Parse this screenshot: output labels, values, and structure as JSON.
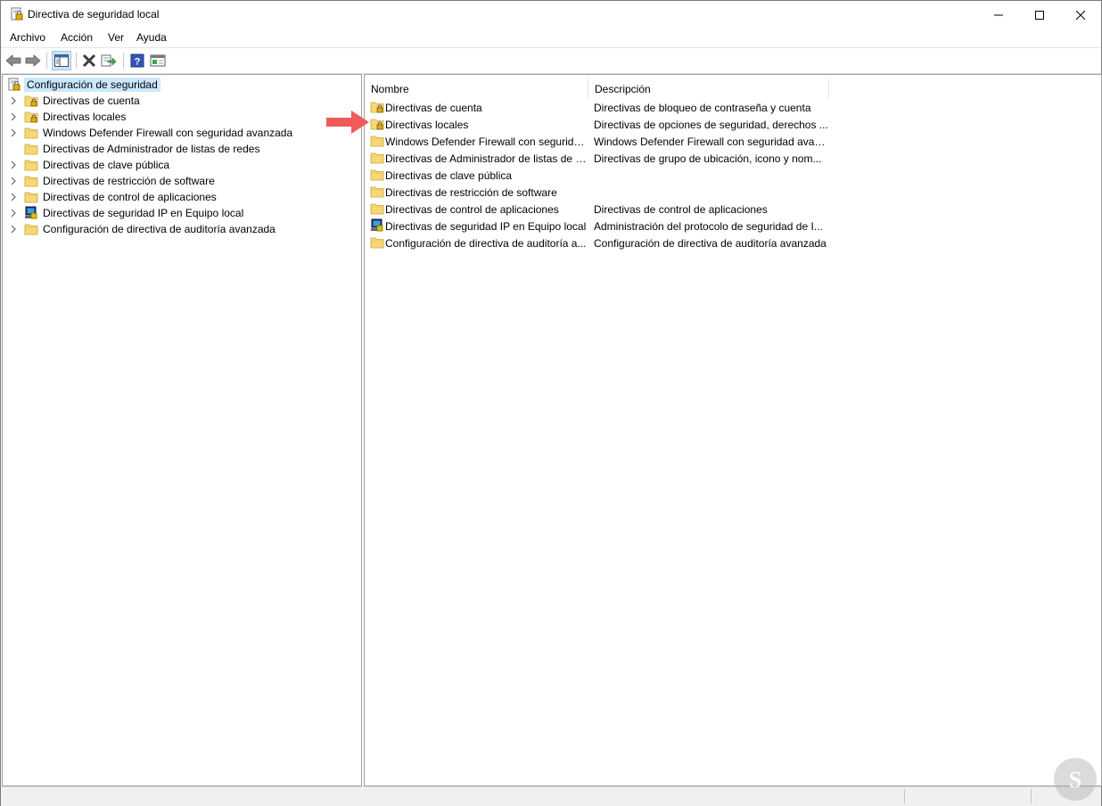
{
  "window": {
    "title": "Directiva de seguridad local"
  },
  "menu": [
    "Archivo",
    "Acción",
    "Ver",
    "Ayuda"
  ],
  "toolbar": {
    "icons": [
      "back-icon",
      "forward-icon",
      "show-hide-tree-icon",
      "delete-icon",
      "export-list-icon",
      "help-icon",
      "properties-icon"
    ]
  },
  "tree": {
    "root": "Configuración de seguridad",
    "items": [
      {
        "label": "Directivas de cuenta",
        "icon": "folder-lock-icon",
        "expandable": true
      },
      {
        "label": "Directivas locales",
        "icon": "folder-lock-icon",
        "expandable": true
      },
      {
        "label": "Windows Defender Firewall con seguridad avanzada",
        "icon": "folder-icon",
        "expandable": true
      },
      {
        "label": "Directivas de Administrador de listas de redes",
        "icon": "folder-icon",
        "expandable": false
      },
      {
        "label": "Directivas de clave pública",
        "icon": "folder-icon",
        "expandable": true
      },
      {
        "label": "Directivas de restricción de software",
        "icon": "folder-icon",
        "expandable": true
      },
      {
        "label": "Directivas de control de aplicaciones",
        "icon": "folder-icon",
        "expandable": true
      },
      {
        "label": "Directivas de seguridad IP en Equipo local",
        "icon": "ip-security-icon",
        "expandable": true
      },
      {
        "label": "Configuración de directiva de auditoría avanzada",
        "icon": "folder-icon",
        "expandable": true
      }
    ]
  },
  "list": {
    "columns": [
      "Nombre",
      "Descripción"
    ],
    "rows": [
      {
        "name": "Directivas de cuenta",
        "desc": "Directivas de bloqueo de contraseña y cuenta",
        "icon": "folder-lock-icon"
      },
      {
        "name": "Directivas locales",
        "desc": "Directivas de opciones de seguridad, derechos ...",
        "icon": "folder-lock-icon"
      },
      {
        "name": "Windows Defender Firewall con segurida...",
        "desc": "Windows Defender Firewall con seguridad avan...",
        "icon": "folder-icon"
      },
      {
        "name": "Directivas de Administrador de listas de r...",
        "desc": "Directivas de grupo de ubicación, icono y nom...",
        "icon": "folder-icon"
      },
      {
        "name": "Directivas de clave pública",
        "desc": "",
        "icon": "folder-icon"
      },
      {
        "name": "Directivas de restricción de software",
        "desc": "",
        "icon": "folder-icon"
      },
      {
        "name": "Directivas de control de aplicaciones",
        "desc": "Directivas de control de aplicaciones",
        "icon": "folder-icon"
      },
      {
        "name": "Directivas de seguridad IP en Equipo local",
        "desc": "Administración del protocolo de seguridad de I...",
        "icon": "ip-security-icon"
      },
      {
        "name": "Configuración de directiva de auditoría a...",
        "desc": "Configuración de directiva de auditoría avanzada",
        "icon": "folder-icon"
      }
    ]
  },
  "colors": {
    "selection": "#cce8ff",
    "folder": "#f8d775",
    "arrow": "#f05a5a"
  }
}
